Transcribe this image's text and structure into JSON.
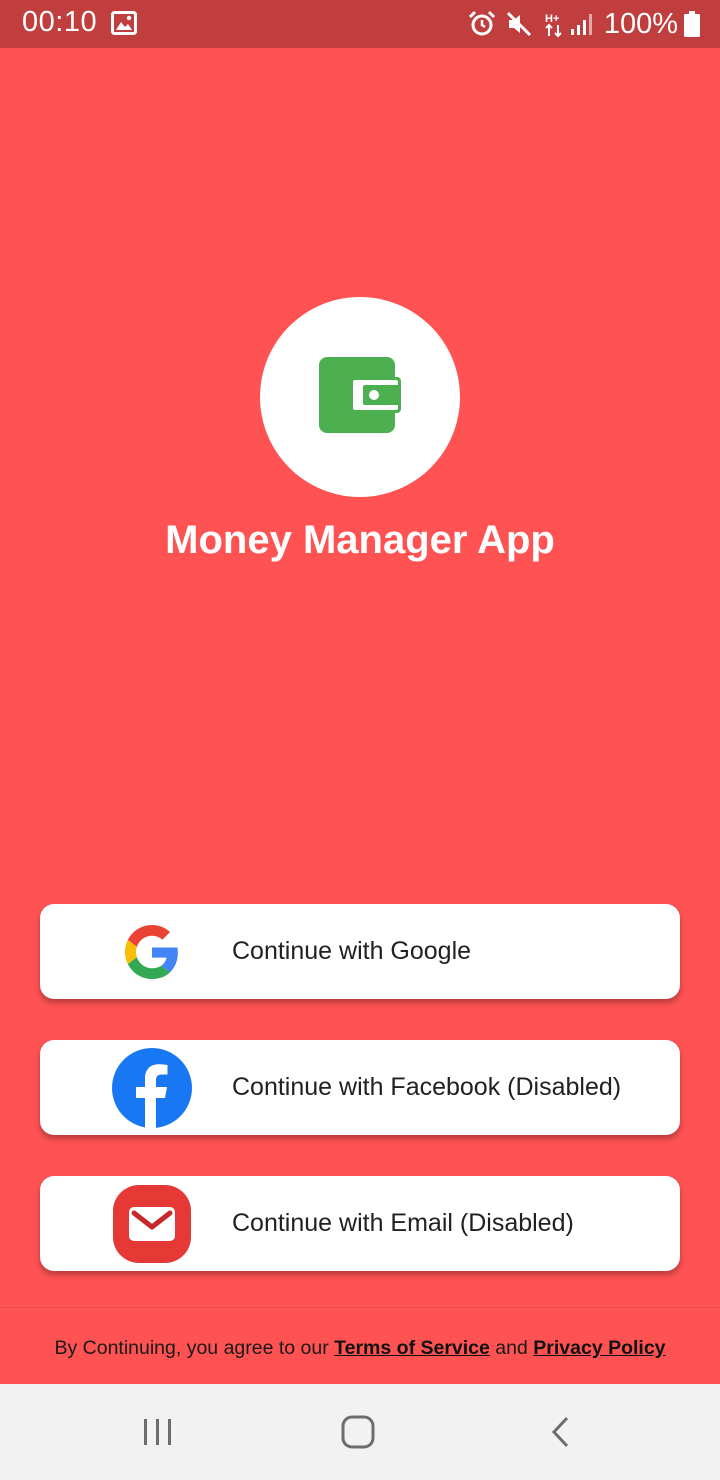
{
  "status_bar": {
    "time": "00:10",
    "battery": "100%",
    "network_label": "H+",
    "icons": [
      "gallery-icon",
      "alarm-icon",
      "mute-icon",
      "hplus-icon",
      "signal-icon",
      "battery-icon"
    ]
  },
  "app": {
    "title": "Money Manager App",
    "logo_icon": "wallet-icon",
    "accent_color": "#ff5252",
    "logo_color": "#4caf50"
  },
  "auth_buttons": [
    {
      "label": "Continue with Google",
      "icon": "google-icon"
    },
    {
      "label": "Continue with Facebook (Disabled)",
      "icon": "facebook-icon"
    },
    {
      "label": "Continue with Email (Disabled)",
      "icon": "email-icon"
    }
  ],
  "legal": {
    "prefix": "By Continuing, you agree to our",
    "terms": "Terms of Service",
    "conjunction": "and",
    "privacy": "Privacy Policy"
  },
  "nav_bar": {
    "icons": [
      "recents-icon",
      "home-icon",
      "back-icon"
    ]
  }
}
